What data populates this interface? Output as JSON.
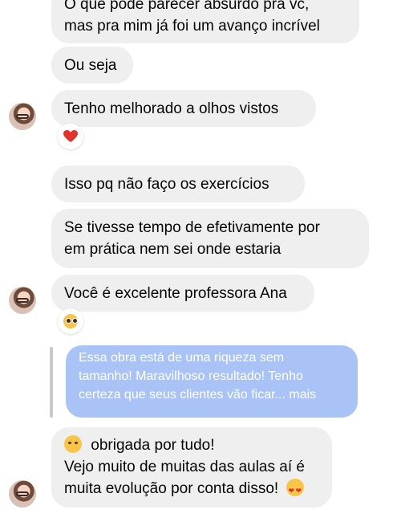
{
  "messages": [
    {
      "lines": [
        "O que pode parecer absurdo pra vc,",
        "mas pra mim já foi um avanço incrível"
      ]
    },
    {
      "lines": [
        "Ou seja"
      ]
    },
    {
      "lines": [
        "Tenho melhorado a olhos vistos"
      ],
      "reaction": "red-heart"
    },
    {
      "lines": [
        "Isso pq não faço os exercícios"
      ]
    },
    {
      "lines": [
        "Se tivesse tempo de efetivamente por",
        "em prática nem sei onde estaria"
      ]
    },
    {
      "lines": [
        "Você é excelente professora Ana"
      ],
      "reaction": "pleading-face"
    },
    {
      "lines": [
        "obrigada por tudo!",
        "Vejo muito de muitas das aulas aí é",
        "muita evolução por conta disso!"
      ]
    }
  ],
  "reply_preview": {
    "lines": [
      "Essa obra está de uma riqueza sem",
      "tamanho! Maravilhoso resultado! Tenho",
      "certeza que seus clientes vão ficar... mais"
    ]
  },
  "colors": {
    "bubble": "#efefef",
    "reply_bubble": "#a9c3f7",
    "heart": "#e0332b"
  },
  "icons": [
    "avatar",
    "red-heart-icon",
    "pleading-face-icon",
    "smiling-face-with-hearts-icon",
    "heart-eyes-icon"
  ]
}
